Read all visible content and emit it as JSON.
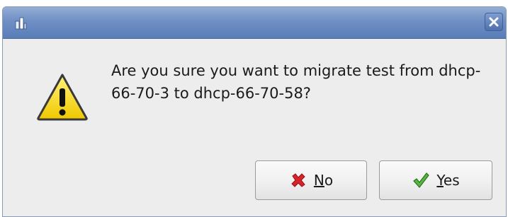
{
  "dialog": {
    "title": "",
    "message": "Are you sure you want to migrate test from dhcp-66-70-3 to dhcp-66-70-58?",
    "icon": "warning-icon"
  },
  "titlebar": {
    "app_icon": "app-icon",
    "close_icon": "close-icon"
  },
  "buttons": {
    "no": {
      "mnemonic": "N",
      "rest": "o",
      "icon": "red-x-icon"
    },
    "yes": {
      "mnemonic": "Y",
      "rest": "es",
      "icon": "green-check-icon"
    }
  },
  "colors": {
    "titlebar": "#6f8fc4",
    "background": "#ededed",
    "warning": "#f3d318",
    "no_icon": "#d8232a",
    "yes_icon": "#3c9a2b"
  }
}
